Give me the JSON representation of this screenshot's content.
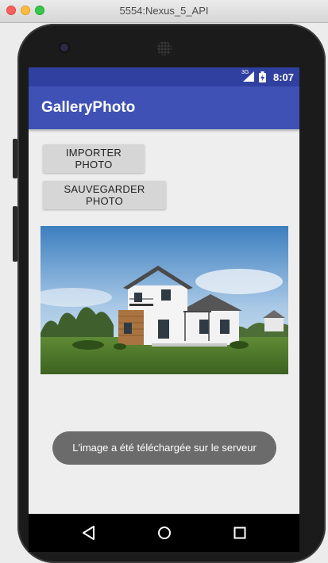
{
  "window": {
    "title": "5554:Nexus_5_API"
  },
  "status_bar": {
    "network": "3G",
    "time": "8:07"
  },
  "app_bar": {
    "title": "GalleryPhoto"
  },
  "buttons": {
    "import_label": "IMPORTER PHOTO",
    "save_label": "SAUVEGARDER PHOTO"
  },
  "photo": {
    "subject": "modern two-storey house on green lawn"
  },
  "toast": {
    "message": "L'image a été téléchargée sur le serveur"
  },
  "nav_bar": {
    "icons": [
      "back-icon",
      "home-icon",
      "recents-icon"
    ]
  },
  "colors": {
    "primary": "#3f51b5",
    "primary_dark": "#3040a0",
    "toast": "#6b6b6b"
  }
}
